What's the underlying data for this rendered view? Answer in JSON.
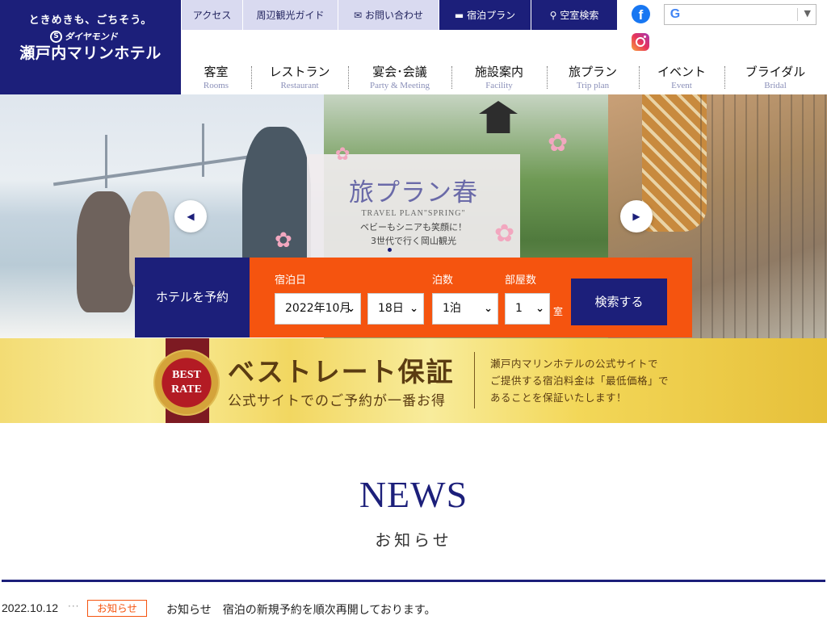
{
  "brand": {
    "tagline": "ときめきも、ごちそう。",
    "sub_brand": "ダイヤモンド",
    "name": "瀬戸内マリンホテル",
    "primary_color": "#1c1f7a",
    "accent_color": "#f5540f"
  },
  "util_nav": [
    {
      "label": "アクセス",
      "icon": ""
    },
    {
      "label": "周辺観光ガイド",
      "icon": ""
    },
    {
      "label": "お問い合わせ",
      "icon": "envelope-icon"
    },
    {
      "label": "宿泊プラン",
      "icon": "bed-icon"
    },
    {
      "label": "空室検索",
      "icon": "search-icon"
    }
  ],
  "social": {
    "facebook": "facebook-icon",
    "instagram": "instagram-icon"
  },
  "translate": {
    "icon": "google-icon",
    "selected": ""
  },
  "main_nav": [
    {
      "jp": "客室",
      "en": "Rooms"
    },
    {
      "jp": "レストラン",
      "en": "Restaurant"
    },
    {
      "jp": "宴会･会議",
      "en": "Party & Meeting"
    },
    {
      "jp": "施設案内",
      "en": "Facility"
    },
    {
      "jp": "旅プラン",
      "en": "Trip plan"
    },
    {
      "jp": "イベント",
      "en": "Event"
    },
    {
      "jp": "ブライダル",
      "en": "Bridal"
    }
  ],
  "hero": {
    "title": "旅プラン春",
    "title_en": "TRAVEL PLAN\"SPRING\"",
    "line1": "ベビーもシニアも笑顔に！",
    "line2": "3世代で行く岡山観光",
    "prev_icon": "chevron-left-icon",
    "next_icon": "chevron-right-icon"
  },
  "booking": {
    "label": "ホテルを予約",
    "date_label": "宿泊日",
    "month_value": "2022年10月",
    "day_value": "18日",
    "nights_label": "泊数",
    "nights_value": "1泊",
    "rooms_label": "部屋数",
    "rooms_value": "1",
    "rooms_unit": "室",
    "search_label": "検索する"
  },
  "best_rate": {
    "badge_line1": "BEST",
    "badge_line2": "RATE",
    "title": "ベストレート保証",
    "subtitle": "公式サイトでのご予約が一番お得",
    "desc_line1": "瀬戸内マリンホテルの公式サイトで",
    "desc_line2": "ご提供する宿泊料金は「最低価格」で",
    "desc_line3": "あることを保証いたします！"
  },
  "news": {
    "title": "NEWS",
    "subtitle": "お知らせ",
    "items": [
      {
        "date": "2022.10.12",
        "dots": "···",
        "category": "お知らせ",
        "text": "お知らせ　宿泊の新規予約を順次再開しております。"
      }
    ]
  }
}
